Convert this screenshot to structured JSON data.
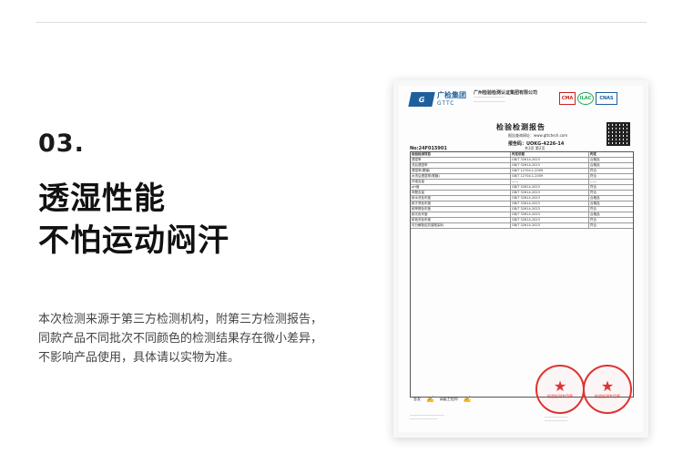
{
  "section": {
    "number": "03.",
    "title_line1": "透湿性能",
    "title_line2": "不怕运动闷汗",
    "description_lines": [
      "本次检测来源于第三方检测机构，附第三方检测报告，",
      "同款产品不同批次不同颜色的检测结果存在微小差异，",
      "不影响产品使用，具体请以实物为准。"
    ]
  },
  "report": {
    "logo_cn": "广检集团",
    "logo_en": "GTTC",
    "institute_name": "广州检验检测认证集团有限公司",
    "title": "检验检测报告",
    "query_site": "报告查询网址：www.gttctech.com",
    "report_code": "报告码：UOKG-4226-14",
    "report_no": "No:24F015901",
    "page": "共3页  第2页",
    "headers": [
      "检验检测项目",
      "判定依据",
      "判定"
    ],
    "rows": [
      [
        "透湿率",
        "GB/T 32614-2023",
        "合格品"
      ],
      [
        "洗后透湿率",
        "GB/T 32614-2023",
        "合格品"
      ],
      [
        "透湿率(覆膜)",
        "GB/T 12704.1-2009",
        "符合"
      ],
      [
        "水洗后透湿率(覆膜)",
        "GB/T 12704.1-2009",
        "符合"
      ],
      [
        "纤维含量",
        "——",
        "——"
      ],
      [
        "pH值",
        "GB/T 32614-2023",
        "符合"
      ],
      [
        "甲醛含量",
        "GB/T 32614-2023",
        "符合"
      ],
      [
        "耐水洗色牢度",
        "GB/T 32614-2023",
        "合格品"
      ],
      [
        "耐汗渍色牢度",
        "GB/T 32614-2023",
        "合格品"
      ],
      [
        "耐摩擦色牢度",
        "GB/T 32614-2023",
        "符合"
      ],
      [
        "耐光色牢度",
        "GB/T 32614-2023",
        "合格品"
      ],
      [
        "耐皂洗色牢度",
        "GB/T 32614-2023",
        "符合"
      ],
      [
        "可分解致癌芳香胺染料",
        "GB/T 32614-2023",
        "符合"
      ]
    ],
    "signature_label": "签发",
    "approver_title": "高级工程师",
    "stamp_text": "检验检测专用章",
    "cert_cma": "CMA",
    "cert_ilac": "ILAC",
    "cert_cnas": "CNAS"
  },
  "colors": {
    "brand_blue": "#1f5f9c",
    "stamp_red": "#dd3333",
    "title_text": "#111111",
    "body_text": "#444444"
  }
}
